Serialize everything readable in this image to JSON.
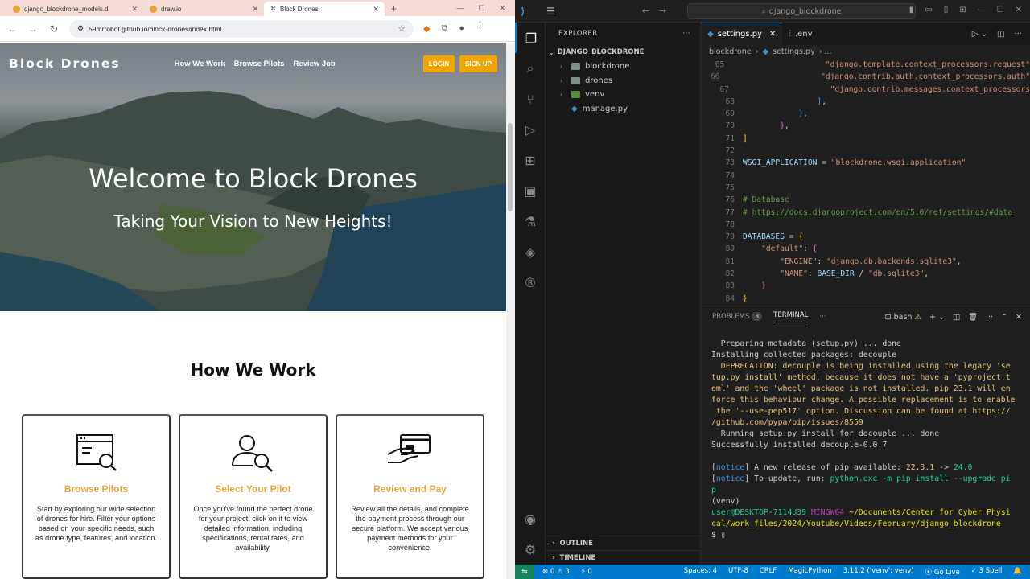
{
  "browser": {
    "tabs": [
      {
        "label": "django_blockdrone_models.d"
      },
      {
        "label": "draw.io"
      },
      {
        "label": "Block Drones"
      }
    ],
    "url": "59mrrobot.github.io/block-drones/index.html"
  },
  "site": {
    "brand": "Block Drones",
    "nav": [
      "How We Work",
      "Browse Pilots",
      "Review Job"
    ],
    "login": "LOGIN",
    "signup": "SIGN UP",
    "hero_title": "Welcome to Block Drones",
    "hero_subtitle": "Taking Your Vision to New Heights!",
    "section_title": "How We Work",
    "cards": [
      {
        "title": "Browse Pilots",
        "icon": "browser-search-icon",
        "text": "Start by exploring our wide selection of drones for hire. Filter your options based on your specific needs, such as drone type, features, and location."
      },
      {
        "title": "Select Your Pilot",
        "icon": "user-search-icon",
        "text": "Once you've found the perfect drone for your project, click on it to view detailed information, including specifications, rental rates, and availability."
      },
      {
        "title": "Review and Pay",
        "icon": "card-payment-icon",
        "text": "Review all the details, and complete the payment process through our secure platform. We accept various payment methods for your convenience."
      }
    ]
  },
  "vscode": {
    "search": "django_blockdrone",
    "explorer_title": "EXPLORER",
    "project": "DJANGO_BLOCKDRONE",
    "tree": [
      {
        "name": "blockdrone",
        "type": "folder"
      },
      {
        "name": "drones",
        "type": "folder"
      },
      {
        "name": "venv",
        "type": "folder"
      },
      {
        "name": "manage.py",
        "type": "file"
      }
    ],
    "outline": "OUTLINE",
    "timeline": "TIMELINE",
    "editor_tabs": [
      {
        "label": "settings.py"
      },
      {
        "label": ".env"
      }
    ],
    "breadcrumb_folder": "blockdrone",
    "breadcrumb_file": "settings.py",
    "panel_tabs": {
      "problems": "PROBLEMS",
      "problems_count": "3",
      "terminal": "TERMINAL",
      "shell": "bash"
    },
    "status": {
      "errors": "0",
      "warnings": "3",
      "ports": "0",
      "spaces": "Spaces: 4",
      "encoding": "UTF-8",
      "eol": "CRLF",
      "lang": "MagicPython",
      "interpreter": "3.11.2 ('venv': venv)",
      "golive": "Go Live",
      "spell": "3 Spell"
    }
  },
  "colors": {
    "accent": "#f0a500",
    "vscode_blue": "#007acc"
  }
}
